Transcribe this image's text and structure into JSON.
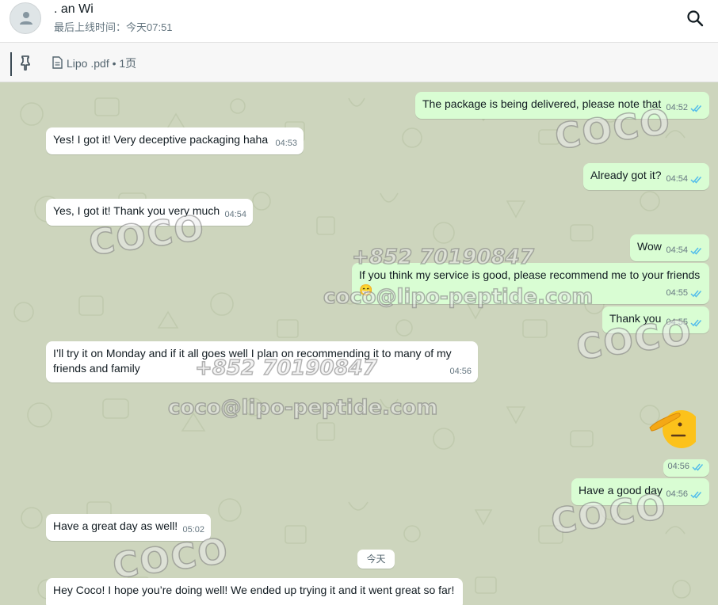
{
  "header": {
    "contact_name": ".      an Wi",
    "last_seen": "最后上线时间：今天07:51",
    "search_icon": "search-icon",
    "avatar_icon": "person-icon"
  },
  "pinned": {
    "label": "Lipo              .pdf • 1页",
    "pin_icon": "pin-icon",
    "doc_icon": "document-icon"
  },
  "messages": [
    {
      "dir": "out",
      "text": "The package is being delivered, please note that",
      "time": "04:52",
      "status": "read"
    },
    {
      "dir": "in",
      "text": "Yes! I got it! Very deceptive packaging haha",
      "time": "04:53"
    },
    {
      "dir": "out",
      "text": "Already got it?",
      "time": "04:54",
      "status": "read"
    },
    {
      "dir": "in",
      "text": "Yes, I got it! Thank you very much",
      "time": "04:54"
    },
    {
      "dir": "out",
      "text": "Wow",
      "time": "04:54",
      "status": "read"
    },
    {
      "dir": "out",
      "text": "If you think my service is good, please recommend me to your friends",
      "emoji": "😁",
      "time": "04:55",
      "status": "read"
    },
    {
      "dir": "out",
      "text": "Thank you",
      "time": "04:55",
      "status": "read"
    },
    {
      "dir": "in",
      "text": "I’ll try it on Monday and if it all goes well I plan on recommending it to many of my friends and family",
      "time": "04:56"
    },
    {
      "dir": "out",
      "type": "sticker",
      "emoji": "🫡",
      "time": "04:56",
      "status": "read"
    },
    {
      "dir": "out",
      "text": "Have a good day",
      "time": "04:56",
      "status": "read"
    },
    {
      "dir": "in",
      "text": "Have a great day as well!",
      "time": "05:02"
    },
    {
      "dir": "in",
      "text": "Hey Coco! I hope you’re doing well! We ended up trying it and it went great so far!",
      "time": ""
    }
  ],
  "day_divider": "今天",
  "watermarks": {
    "brand": "COCO",
    "phone": "+852 70190847",
    "email": "coco@lipo-peptide.com"
  },
  "colors": {
    "outgoing_bubble": "#d9fdd3",
    "incoming_bubble": "#ffffff",
    "read_tick": "#53bdeb",
    "chat_background": "#cdd5bd"
  }
}
